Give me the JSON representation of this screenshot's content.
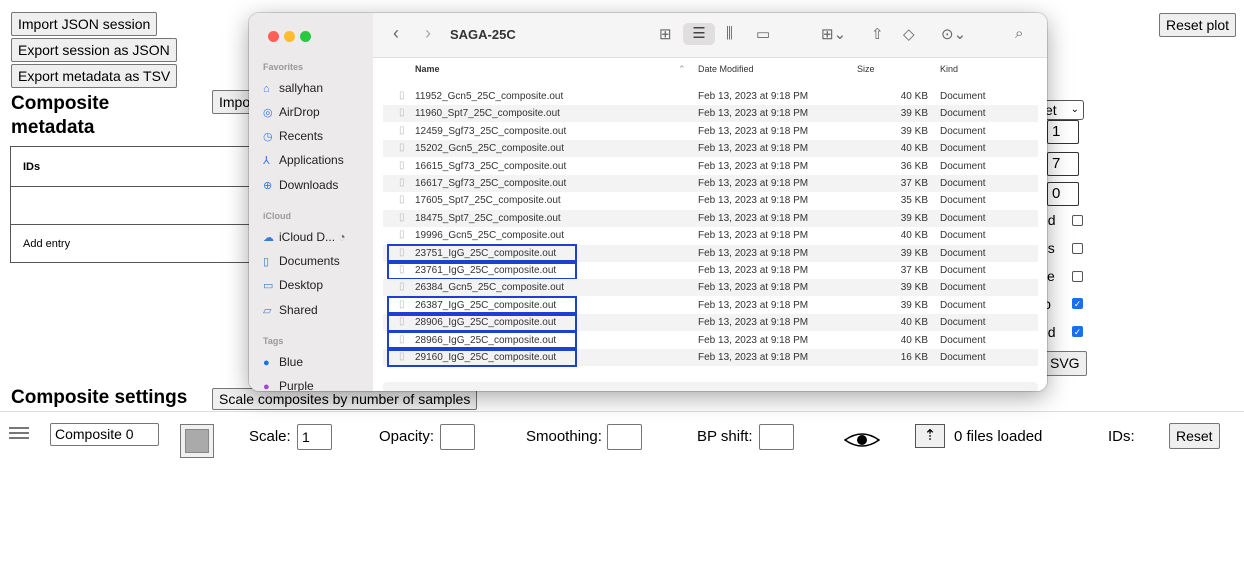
{
  "page": {
    "buttons": {
      "import_json": "Import JSON session",
      "export_json": "Export session as JSON",
      "export_tsv": "Export metadata as TSV",
      "reset_plot": "Reset plot",
      "import_partial": "Impo",
      "scale_composites": "Scale composites by number of samples",
      "reset": "Reset",
      "svg": "SVG"
    },
    "composite_metadata": {
      "title_line1": "Composite",
      "title_line2": "metadata",
      "ids_header": "IDs",
      "add_entry": "Add entry"
    },
    "right_column": {
      "select_partial": "et",
      "values": [
        "1",
        "7",
        "0"
      ],
      "checkbox_labels": [
        "ed",
        "ds",
        "ce",
        "ip",
        "nd"
      ],
      "checkbox_states": [
        false,
        false,
        false,
        true,
        true
      ]
    },
    "composite_settings": {
      "title": "Composite settings",
      "composite_name": "Composite 0",
      "scale_label": "Scale:",
      "scale_value": "1",
      "opacity_label": "Opacity:",
      "smoothing_label": "Smoothing:",
      "bp_shift_label": "BP shift:",
      "files_loaded": "0 files loaded",
      "ids_label": "IDs:"
    }
  },
  "finder": {
    "title": "SAGA-25C",
    "sidebar": {
      "favorites_label": "Favorites",
      "favorites": [
        "sallyhan",
        "AirDrop",
        "Recents",
        "Applications",
        "Downloads"
      ],
      "icloud_label": "iCloud",
      "icloud": [
        "iCloud D...",
        "Documents",
        "Desktop",
        "Shared"
      ],
      "tags_label": "Tags",
      "tags": [
        {
          "name": "Blue",
          "color": "#1a6ff0"
        },
        {
          "name": "Purple",
          "color": "#a04ad0"
        }
      ]
    },
    "columns": {
      "name": "Name",
      "date": "Date Modified",
      "size": "Size",
      "kind": "Kind"
    },
    "files": [
      {
        "name": "11952_Gcn5_25C_composite.out",
        "date": "Feb 13, 2023 at 9:18 PM",
        "size": "40 KB",
        "kind": "Document",
        "selected": false
      },
      {
        "name": "11960_Spt7_25C_composite.out",
        "date": "Feb 13, 2023 at 9:18 PM",
        "size": "39 KB",
        "kind": "Document",
        "selected": false
      },
      {
        "name": "12459_Sgf73_25C_composite.out",
        "date": "Feb 13, 2023 at 9:18 PM",
        "size": "39 KB",
        "kind": "Document",
        "selected": false
      },
      {
        "name": "15202_Gcn5_25C_composite.out",
        "date": "Feb 13, 2023 at 9:18 PM",
        "size": "40 KB",
        "kind": "Document",
        "selected": false
      },
      {
        "name": "16615_Sgf73_25C_composite.out",
        "date": "Feb 13, 2023 at 9:18 PM",
        "size": "36 KB",
        "kind": "Document",
        "selected": false
      },
      {
        "name": "16617_Sgf73_25C_composite.out",
        "date": "Feb 13, 2023 at 9:18 PM",
        "size": "37 KB",
        "kind": "Document",
        "selected": false
      },
      {
        "name": "17605_Spt7_25C_composite.out",
        "date": "Feb 13, 2023 at 9:18 PM",
        "size": "35 KB",
        "kind": "Document",
        "selected": false
      },
      {
        "name": "18475_Spt7_25C_composite.out",
        "date": "Feb 13, 2023 at 9:18 PM",
        "size": "39 KB",
        "kind": "Document",
        "selected": false
      },
      {
        "name": "19996_Gcn5_25C_composite.out",
        "date": "Feb 13, 2023 at 9:18 PM",
        "size": "40 KB",
        "kind": "Document",
        "selected": false
      },
      {
        "name": "23751_IgG_25C_composite.out",
        "date": "Feb 13, 2023 at 9:18 PM",
        "size": "39 KB",
        "kind": "Document",
        "selected": true
      },
      {
        "name": "23761_IgG_25C_composite.out",
        "date": "Feb 13, 2023 at 9:18 PM",
        "size": "37 KB",
        "kind": "Document",
        "selected": true
      },
      {
        "name": "26384_Gcn5_25C_composite.out",
        "date": "Feb 13, 2023 at 9:18 PM",
        "size": "39 KB",
        "kind": "Document",
        "selected": false
      },
      {
        "name": "26387_IgG_25C_composite.out",
        "date": "Feb 13, 2023 at 9:18 PM",
        "size": "39 KB",
        "kind": "Document",
        "selected": true
      },
      {
        "name": "28906_IgG_25C_composite.out",
        "date": "Feb 13, 2023 at 9:18 PM",
        "size": "40 KB",
        "kind": "Document",
        "selected": true
      },
      {
        "name": "28966_IgG_25C_composite.out",
        "date": "Feb 13, 2023 at 9:18 PM",
        "size": "40 KB",
        "kind": "Document",
        "selected": true
      },
      {
        "name": "29160_IgG_25C_composite.out",
        "date": "Feb 13, 2023 at 9:18 PM",
        "size": "16 KB",
        "kind": "Document",
        "selected": true
      }
    ]
  }
}
